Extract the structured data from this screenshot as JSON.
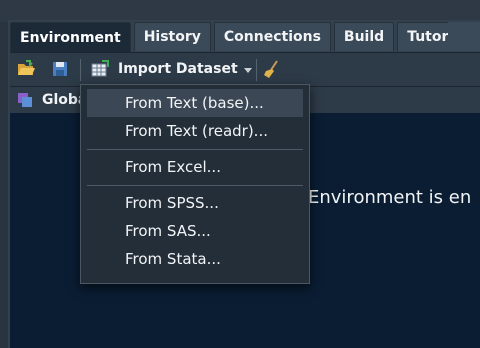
{
  "tabs": [
    {
      "label": "Environment",
      "active": true
    },
    {
      "label": "History",
      "active": false
    },
    {
      "label": "Connections",
      "active": false
    },
    {
      "label": "Build",
      "active": false
    },
    {
      "label": "Tutorial",
      "active": false
    }
  ],
  "toolbar": {
    "open_icon": "folder-open-icon",
    "save_icon": "save-disk-icon",
    "import_icon": "table-import-icon",
    "import_label": "Import Dataset",
    "clear_icon": "broom-icon"
  },
  "envbar": {
    "icon": "global-environment-icon",
    "label": "Globa"
  },
  "main": {
    "empty_message": "Environment is en"
  },
  "import_menu": {
    "items": [
      {
        "label": "From Text (base)...",
        "highlighted": true
      },
      {
        "label": "From Text (readr)...",
        "highlighted": false
      },
      {
        "label": "From Excel...",
        "highlighted": false
      },
      {
        "label": "From SPSS...",
        "highlighted": false
      },
      {
        "label": "From SAS...",
        "highlighted": false
      },
      {
        "label": "From Stata...",
        "highlighted": false
      }
    ]
  },
  "colors": {
    "background": "#0a1d33",
    "tab_active": "#1c2936",
    "tab_inactive": "#3b4a58",
    "menu_bg": "#232e39",
    "menu_highlight": "#3b4754"
  }
}
